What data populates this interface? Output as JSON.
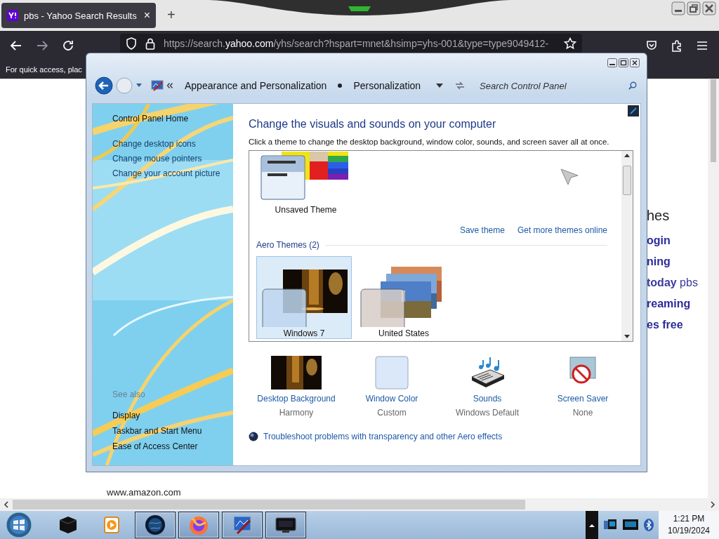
{
  "browser": {
    "tab": {
      "title": "pbs - Yahoo Search Results",
      "close": "×",
      "selected": true
    },
    "new_tab": "+",
    "url": "https://search.**yahoo.com**/yhs/search?hspart=mnet&hsimp=yhs-001&type=type9049412-",
    "bookmarks_hint": "For quick access, plac"
  },
  "page": {
    "results": [
      {
        "text": "hes",
        "kind": "heading"
      },
      {
        "text": "ogin",
        "kind": "link"
      },
      {
        "text": "ning",
        "kind": "link"
      },
      {
        "text": "**today** pbs",
        "kind": "snippet"
      },
      {
        "text": "reaming",
        "kind": "link"
      },
      {
        "text": "es free",
        "kind": "link"
      }
    ],
    "footer_link": "www.amazon.com"
  },
  "window": {
    "breadcrumb": [
      "Appearance and Personalization",
      "Personalization"
    ],
    "search_placeholder": "Search Control Panel",
    "sidebar": {
      "home": "Control Panel Home",
      "tasks": [
        "Change desktop icons",
        "Change mouse pointers",
        "Change your account picture"
      ],
      "see_also_label": "See also",
      "see_also": [
        "Display",
        "Taskbar and Start Menu",
        "Ease of Access Center"
      ]
    },
    "title": "Change the visuals and sounds on your computer",
    "description": "Click a theme to change the desktop background, window color, sounds, and screen saver all at once.",
    "my_themes": [
      {
        "name": "Unsaved Theme",
        "kind": "custom",
        "selected": false
      }
    ],
    "links": [
      "Save theme",
      "Get more themes online"
    ],
    "aero_label": "Aero Themes (2)",
    "aero_themes": [
      {
        "name": "Windows 7",
        "kind": "harmony",
        "selected": true
      },
      {
        "name": "United States",
        "kind": "landscape",
        "selected": false
      }
    ],
    "settings": [
      {
        "kind": "background",
        "label": "Desktop Background",
        "value": "Harmony"
      },
      {
        "kind": "color",
        "label": "Window Color",
        "value": "Custom"
      },
      {
        "kind": "sounds",
        "label": "Sounds",
        "value": "Windows Default"
      },
      {
        "kind": "screensaver",
        "label": "Screen Saver",
        "value": "None"
      }
    ],
    "troubleshoot": "Troubleshoot problems with transparency and other Aero effects"
  },
  "taskbar": {
    "items": [
      {
        "kind": "box",
        "running": false
      },
      {
        "kind": "media",
        "running": false
      },
      {
        "kind": "globe",
        "running": true
      },
      {
        "kind": "firefox",
        "running": true
      },
      {
        "kind": "panel",
        "running": true
      },
      {
        "kind": "screen",
        "running": true
      }
    ],
    "time": "1:21 PM",
    "date": "10/19/2024"
  }
}
